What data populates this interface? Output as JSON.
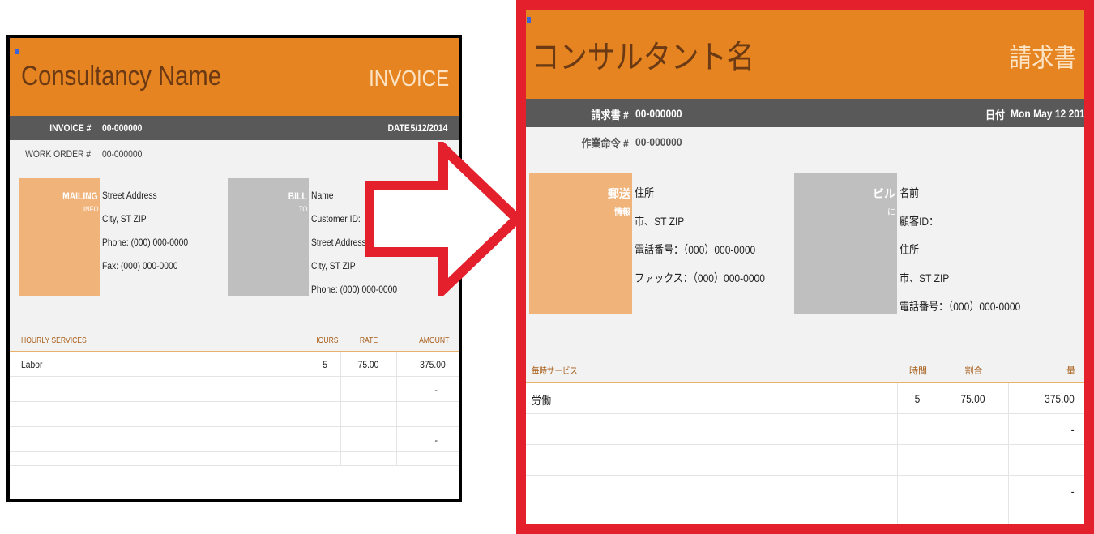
{
  "english": {
    "consultancy_name": "Consultancy Name",
    "invoice_title": "INVOICE",
    "invoice_label": "INVOICE #",
    "invoice_number": "00-000000",
    "date_label": "DATE",
    "date_value": "5/12/2014",
    "work_order_label": "WORK ORDER #",
    "work_order_number": "00-000000",
    "mailing_label": "MAILING",
    "mailing_sub": "INFO",
    "mailing_lines": [
      "Street Address",
      "City, ST  ZIP",
      "Phone: (000) 000-0000",
      "Fax: (000) 000-0000"
    ],
    "bill_label": "BILL",
    "bill_sub": "TO",
    "bill_lines": [
      "Name",
      "Customer ID:",
      "Street Address",
      "City, ST  ZIP",
      "Phone: (000) 000-0000"
    ],
    "table_headers": [
      "HOURLY SERVICES",
      "HOURS",
      "RATE",
      "AMOUNT"
    ],
    "rows": [
      {
        "service": "Labor",
        "hours": "5",
        "rate": "75.00",
        "amount": "375.00"
      },
      {
        "service": "",
        "hours": "",
        "rate": "",
        "amount": "-"
      },
      {
        "service": "",
        "hours": "",
        "rate": "",
        "amount": ""
      },
      {
        "service": "",
        "hours": "",
        "rate": "",
        "amount": "-"
      }
    ]
  },
  "japanese": {
    "consultancy_name": "コンサルタント名",
    "invoice_title": "請求書",
    "invoice_label": "請求書 #",
    "invoice_number": "00-000000",
    "date_label": "日付",
    "date_value": "Mon May 12 201",
    "work_order_label": "作業命令 #",
    "work_order_number": "00-000000",
    "mailing_label": "郵送",
    "mailing_sub": "情報",
    "mailing_lines": [
      "住所",
      "市、ST ZIP",
      "電話番号：（000）000-0000",
      "ファックス：（000）000-0000"
    ],
    "bill_label": "ビル",
    "bill_sub": "に",
    "bill_lines": [
      "名前",
      "顧客ID：",
      "住所",
      "市、ST ZIP",
      "電話番号：（000）000-0000"
    ],
    "table_headers": [
      "毎時サービス",
      "時間",
      "割合",
      "量"
    ],
    "rows": [
      {
        "service": "労働",
        "hours": "5",
        "rate": "75.00",
        "amount": "375.00"
      },
      {
        "service": "",
        "hours": "",
        "rate": "",
        "amount": "-"
      },
      {
        "service": "",
        "hours": "",
        "rate": "",
        "amount": ""
      },
      {
        "service": "",
        "hours": "",
        "rate": "",
        "amount": "-"
      }
    ]
  },
  "colors": {
    "header_orange": "#e58420",
    "bar_gray": "#595959",
    "box_orange": "#f0b37a",
    "box_gray": "#bfbfbf",
    "arrow_red": "#e3202b",
    "left_frame": "#000000",
    "right_frame": "#e3202b"
  },
  "icons": {
    "cell_marker": "selection-marker-icon",
    "arrow": "right-arrow-icon"
  }
}
